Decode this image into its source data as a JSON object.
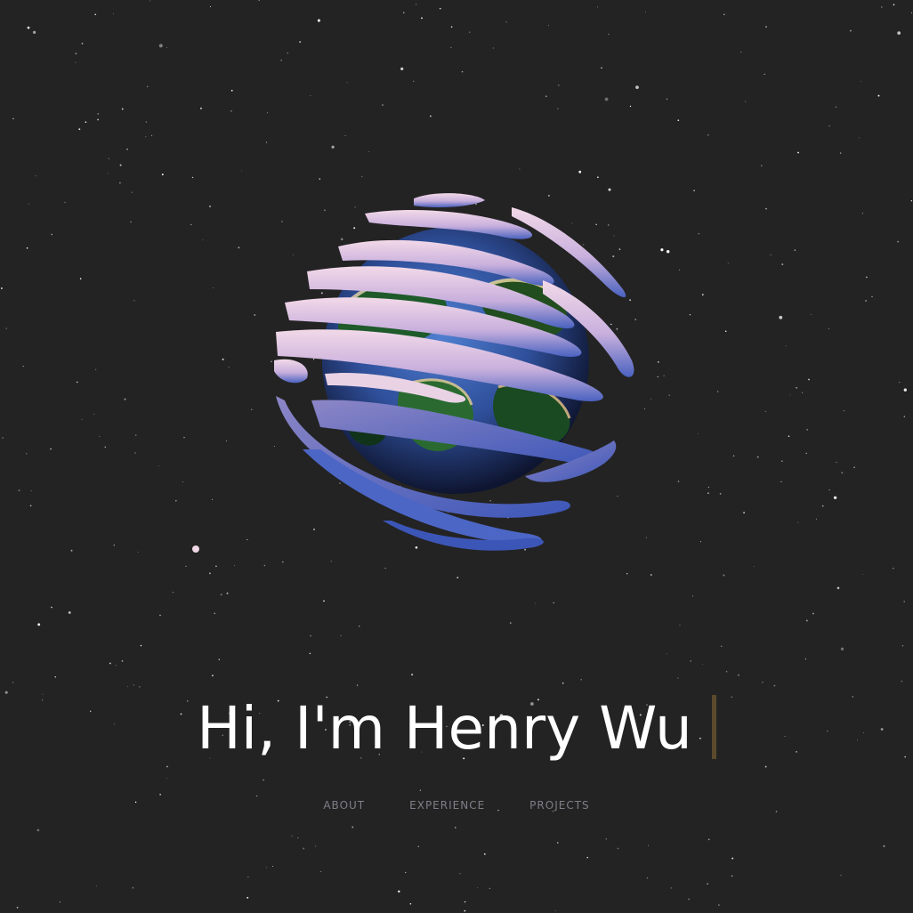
{
  "hero": {
    "title": "Hi, I'm Henry Wu"
  },
  "nav": {
    "items": [
      {
        "label": "ABOUT"
      },
      {
        "label": "EXPERIENCE"
      },
      {
        "label": "PROJECTS"
      }
    ]
  },
  "colors": {
    "background": "#232323",
    "title": "#ffffff",
    "cursor": "#5c4a2c",
    "nav": "#7e7e88"
  }
}
